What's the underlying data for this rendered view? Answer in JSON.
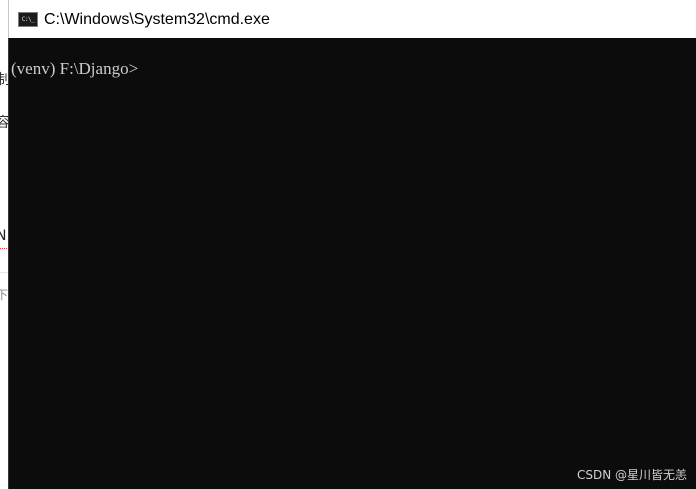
{
  "background_page": {
    "fragment_1": "制",
    "fragment_2": "容",
    "fragment_3": "N",
    "fragment_4": "下"
  },
  "window": {
    "title": "C:\\Windows\\System32\\cmd.exe",
    "icon": "cmd-prompt-icon",
    "icon_glyph": "C:\\_"
  },
  "console": {
    "prompt_line": "(venv) F:\\Django>"
  },
  "watermark": {
    "text": "CSDN @星川皆无恙"
  },
  "colors": {
    "console_background": "#0c0c0c",
    "console_text": "#cccccc",
    "titlebar_background": "#ffffff",
    "title_text": "#000000"
  }
}
